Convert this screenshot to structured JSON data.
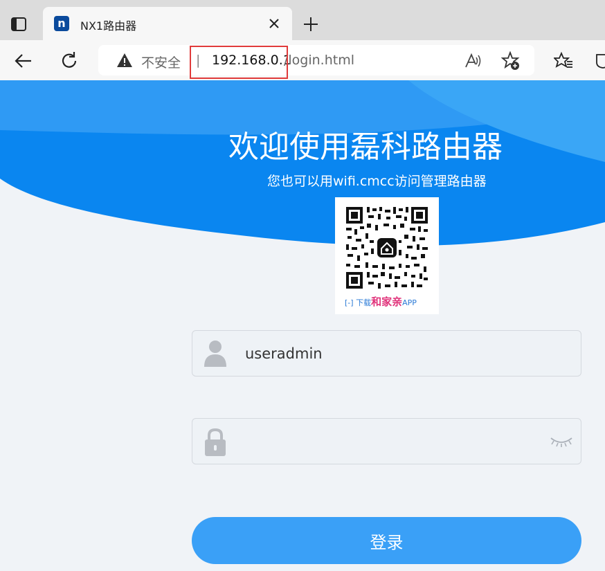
{
  "browser": {
    "tab": {
      "title": "NX1路由器",
      "favicon_letter": "n"
    },
    "address": {
      "insecure_label": "不安全",
      "separator": "|",
      "host": "192.168.0.1",
      "path": "/login.html"
    },
    "icons": [
      "sidebar-icon",
      "close-icon",
      "plus-icon",
      "back-arrow-icon",
      "reload-icon",
      "warning-icon",
      "read-aloud-icon",
      "add-favorite-icon",
      "favorites-icon",
      "collections-icon"
    ]
  },
  "page": {
    "welcome": "欢迎使用磊科路由器",
    "subtitle": "您也可以用wifi.cmcc访问管理路由器",
    "qr": {
      "caption_prefix": "下载",
      "caption_brand": "和家亲",
      "caption_suffix": "APP"
    },
    "username": {
      "value": "useradmin"
    },
    "password": {
      "value": ""
    },
    "login_button": "登录",
    "colors": {
      "banner_blue": "#0a86f0",
      "button_blue": "#3aa0f7",
      "highlight_red": "#e03a3a"
    }
  }
}
